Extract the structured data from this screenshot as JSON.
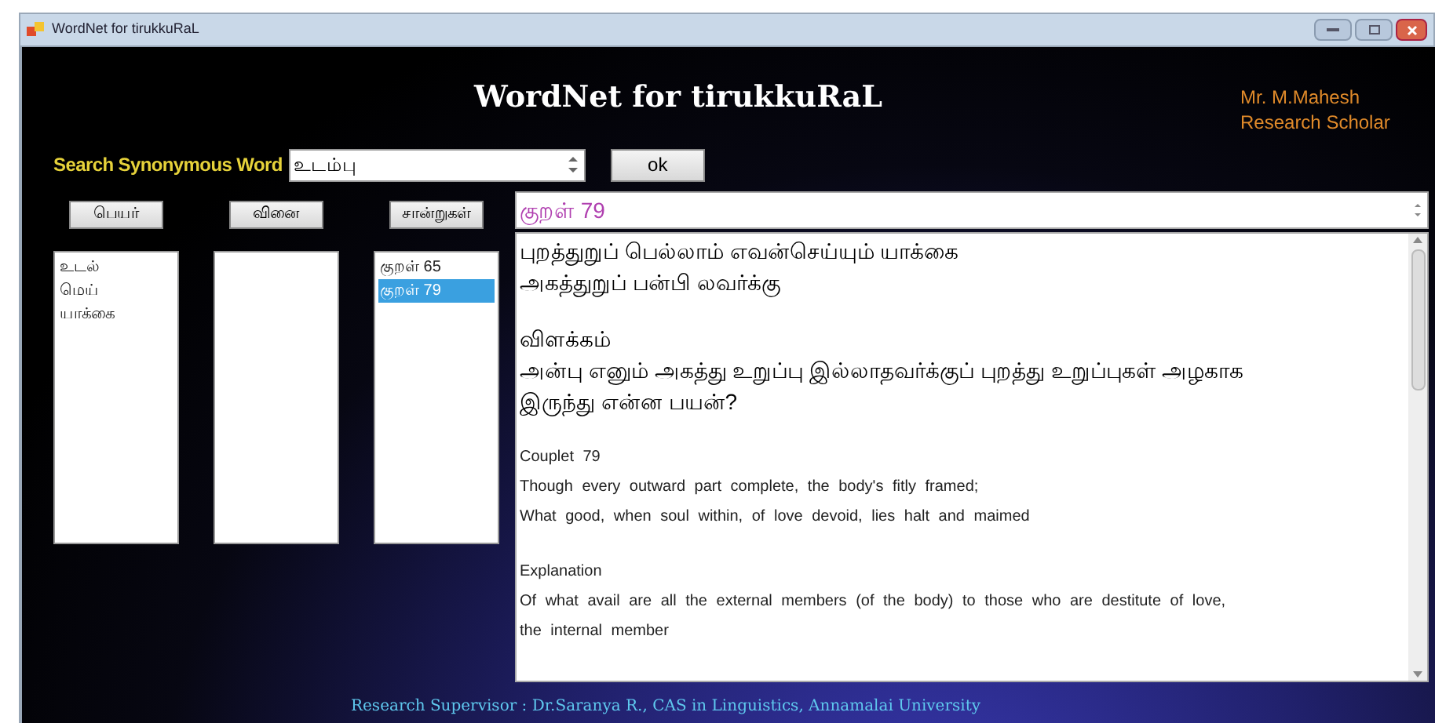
{
  "window": {
    "title": "WordNet for tirukkuRaL"
  },
  "header": {
    "title": "WordNet for tirukkuRaL",
    "author_lines": [
      "Mr. M.Mahesh",
      "Research Scholar"
    ]
  },
  "search": {
    "label": "Search Synonymous Word",
    "value": "உடம்பு",
    "button": "ok"
  },
  "columns": [
    {
      "button": "பெயர்",
      "items": [
        {
          "text": "உடல்",
          "selected": false
        },
        {
          "text": "மெய்",
          "selected": false
        },
        {
          "text": "யாக்கை",
          "selected": false
        }
      ]
    },
    {
      "button": "வினை"
    },
    {
      "button": "சான்றுகள்",
      "items": [
        {
          "text": "குறள் 65",
          "selected": false
        },
        {
          "text": "குறள் 79",
          "selected": true
        }
      ]
    }
  ],
  "result": {
    "heading": "குறள் 79",
    "blocks": [
      {
        "kind": "tamil",
        "lines": [
          "புறத்துறுப் பெல்லாம் எவன்செய்யும் யாக்கை",
          "அகத்துறுப் பன்பி லவர்க்கு"
        ]
      },
      {
        "kind": "tamil",
        "lines": [
          "விளக்கம்",
          "அன்பு எனும் அகத்து உறுப்பு இல்லாதவர்க்குப் புறத்து உறுப்புகள் அழகாக",
          "இருந்து என்ன பயன்?"
        ]
      },
      {
        "kind": "english",
        "lines": [
          "Couplet 79",
          "Though every outward part complete, the body's fitly framed;",
          "What good, when soul within, of love devoid, lies halt and maimed"
        ]
      },
      {
        "kind": "english",
        "lines": [
          "Explanation",
          "Of what avail are all the external members (of the body) to those who are destitute of love,",
          "the internal member"
        ]
      }
    ]
  },
  "footer": "Research Supervisor : Dr.Saranya R., CAS in Linguistics, Annamalai University"
}
